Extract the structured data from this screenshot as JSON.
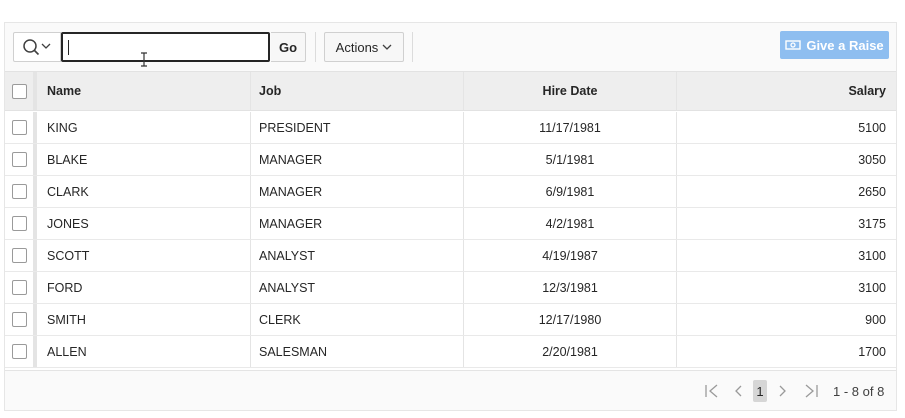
{
  "toolbar": {
    "search_icon": "search-icon",
    "search_placeholder": "",
    "search_value": "",
    "go_label": "Go",
    "actions_label": "Actions",
    "raise_label": "Give a Raise",
    "raise_color": "#8ebef0"
  },
  "table": {
    "columns": [
      "Name",
      "Job",
      "Hire Date",
      "Salary"
    ],
    "rows": [
      {
        "name": "KING",
        "job": "PRESIDENT",
        "hire_date": "11/17/1981",
        "salary": "5100"
      },
      {
        "name": "BLAKE",
        "job": "MANAGER",
        "hire_date": "5/1/1981",
        "salary": "3050"
      },
      {
        "name": "CLARK",
        "job": "MANAGER",
        "hire_date": "6/9/1981",
        "salary": "2650"
      },
      {
        "name": "JONES",
        "job": "MANAGER",
        "hire_date": "4/2/1981",
        "salary": "3175"
      },
      {
        "name": "SCOTT",
        "job": "ANALYST",
        "hire_date": "4/19/1987",
        "salary": "3100"
      },
      {
        "name": "FORD",
        "job": "ANALYST",
        "hire_date": "12/3/1981",
        "salary": "3100"
      },
      {
        "name": "SMITH",
        "job": "CLERK",
        "hire_date": "12/17/1980",
        "salary": "900"
      },
      {
        "name": "ALLEN",
        "job": "SALESMAN",
        "hire_date": "2/20/1981",
        "salary": "1700"
      }
    ]
  },
  "pagination": {
    "current_page": "1",
    "range_text": "1 - 8 of 8"
  }
}
